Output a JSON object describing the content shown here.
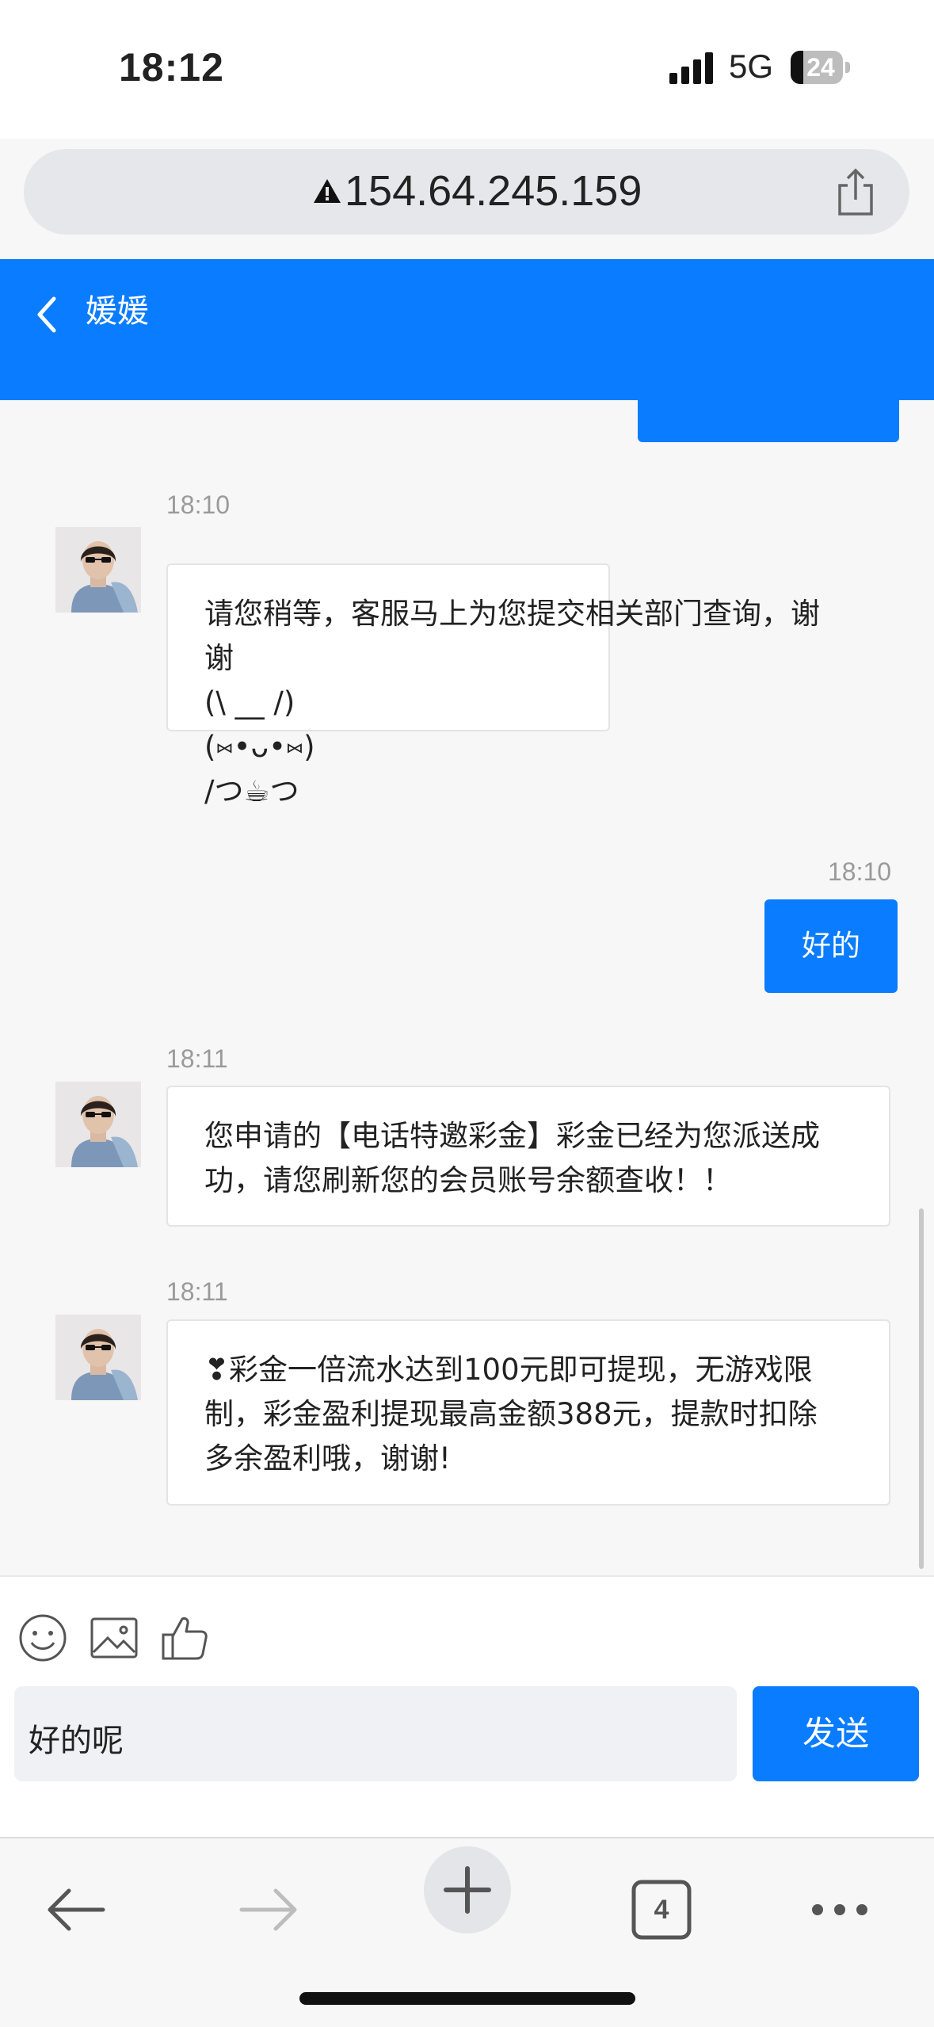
{
  "status_bar": {
    "time": "18:12",
    "network": "5G",
    "battery": "24"
  },
  "browser": {
    "url": "154.64.245.159"
  },
  "chat_header": {
    "title": "媛媛"
  },
  "messages": [
    {
      "time": "18:10",
      "lines": [
        "请您稍等，客服马上为您提交相关部门查询，谢",
        "谢",
        "(\\ __ /)",
        "(⑅•ᴗ•⑅)",
        "/つ☕つ"
      ]
    },
    {
      "time": "18:10",
      "text": "好的"
    },
    {
      "time": "18:11",
      "lines": [
        "您申请的【电话特邀彩金】彩金已经为您派送成",
        "功，请您刷新您的会员账号余额查收！！"
      ]
    },
    {
      "time": "18:11",
      "lines": [
        "❣彩金一倍流水达到100元即可提现，无游戏限",
        "制，彩金盈利提现最高金额388元，提款时扣除",
        "多余盈利哦，谢谢!"
      ]
    }
  ],
  "input": {
    "value": "好的呢",
    "send_label": "发送"
  },
  "bottom_nav": {
    "tab_count": "4"
  },
  "colors": {
    "accent": "#0a7cff",
    "background": "#f7f7f7"
  },
  "icons": [
    "emoji-icon",
    "image-icon",
    "thumbs-up-icon",
    "back-arrow-icon",
    "forward-arrow-icon",
    "plus-icon",
    "tabs-icon",
    "more-icon",
    "share-icon",
    "warning-icon"
  ]
}
